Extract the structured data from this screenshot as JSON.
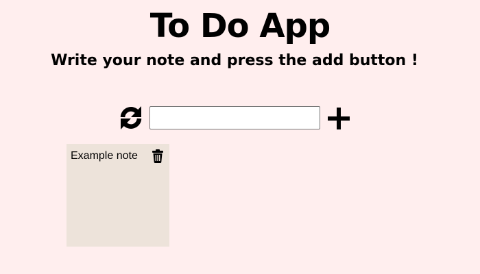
{
  "header": {
    "title": "To Do App",
    "subtitle": "Write your note and press the add button !"
  },
  "toolbar": {
    "refresh_icon": "refresh-icon",
    "input_value": "",
    "input_placeholder": "",
    "add_icon": "plus-icon"
  },
  "notes": [
    {
      "text": "Example note",
      "delete_icon": "trash-icon"
    }
  ],
  "colors": {
    "page_background": "#ffeeee",
    "note_background": "#ede3da",
    "text": "#000000"
  }
}
